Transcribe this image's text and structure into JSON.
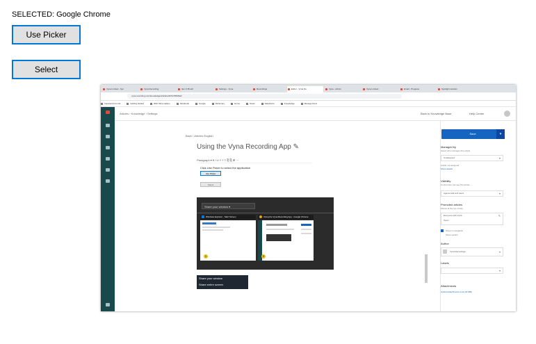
{
  "header": {
    "selected_text": "SELECTED:  Google Chrome"
  },
  "buttons": {
    "use_picker": "Use Picker",
    "select": "Select"
  },
  "screenshot": {
    "tabs": [
      "Vyna Limited - Sys",
      "Vyna Recording",
      "Item 3 Brush",
      "Settings - Vyna",
      "Recordings",
      "Editor - Vyna Re",
      "Vyna - Admin",
      "Vyna Limited",
      "Email - Progress",
      "Spotlight solution"
    ],
    "address": "vyna.recording.com/knowledge/article/edit?id=5f8d3a3",
    "bookmarks": [
      "Imported From IE",
      "Getting started",
      "Web Slice Gallery",
      "Facebook",
      "Google",
      "Dictionary",
      "Home",
      "News",
      "Salesforce",
      "Knowledge",
      "Manage Docs"
    ],
    "breadcrumb": "Articles  ›  Knowledge  ›  Settings",
    "header_right_link": "Back to Knowledge Base",
    "help_link": "Help Center",
    "doc_crumb": "Back  ›  Articles English",
    "doc_title": "Using the Vyna Recording App ✎",
    "toolbar": "Paragraph  ▾   B  I  U   ≡  ≡  ≡   ⎘  ⎘   ⊞  ⋯",
    "body_text": "Click Use Picker to select the application",
    "mini_use_picker": "Use Picker",
    "mini_select": "Select",
    "share_header": "Share your window ▾",
    "win_card_1_title": "Windows Explorer - Start Screen",
    "win_card_2_title": "Using the Vyna Recording App - Google Chrome",
    "badge_1": "1",
    "badge_2": "2",
    "menu_item_1": "Share your window",
    "menu_item_2": "Share entire screen",
    "right_panel": {
      "save": "Save",
      "caret": "▾",
      "managed_by": "Managed by",
      "managed_by_sub": "Select who manages this article",
      "managed_value": "Unassigned",
      "managed_note": "Article not assigned",
      "managed_link": "Show details",
      "visibility": "Visibility",
      "visibility_sub": "Control who can see this article",
      "visibility_value": "Agents and end users",
      "promotion": "Promoted articles",
      "promotion_sub": "Shows at the top of lists",
      "permission_value": "Everyone with Vyna",
      "permission_value_2": "Team",
      "checkbox_label": "Show in navigation",
      "checkbox_sub": "Show section",
      "author": "Author",
      "author_name": "Vyna Recordings",
      "labels": "Labels",
      "attachments": "Attachments",
      "attachments_link": "Upload attachments (max 20 MB)"
    }
  }
}
